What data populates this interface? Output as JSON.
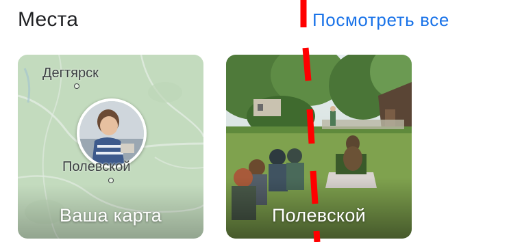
{
  "section": {
    "title": "Места",
    "see_all_label": "Посмотреть все"
  },
  "cards": [
    {
      "kind": "map",
      "label": "Ваша карта",
      "places": [
        "Дегтярск",
        "Полевской"
      ]
    },
    {
      "kind": "photo",
      "label": "Полевской"
    }
  ],
  "colors": {
    "title": "#202124",
    "link": "#1a73e8",
    "map_bg": "#d9ead3",
    "annotation": "#ff0000"
  }
}
